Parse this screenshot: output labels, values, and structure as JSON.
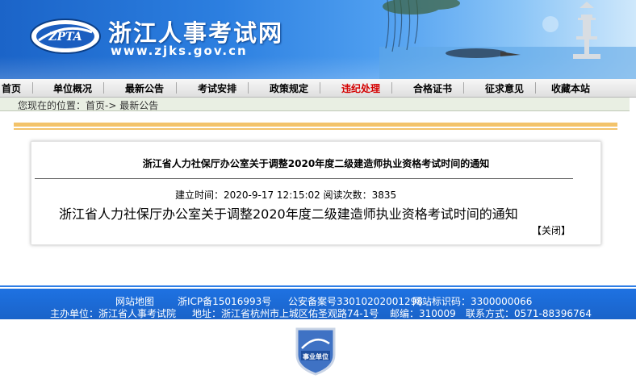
{
  "header": {
    "logo_text": "ZPTA",
    "site_title": "浙江人事考试网",
    "site_url": "www.zjks.gov.cn"
  },
  "nav": {
    "items": [
      {
        "label": "首页"
      },
      {
        "label": "单位概况"
      },
      {
        "label": "最新公告"
      },
      {
        "label": "考试安排"
      },
      {
        "label": "政策规定"
      },
      {
        "label": "违纪处理",
        "active": true
      },
      {
        "label": "合格证书"
      },
      {
        "label": "征求意见"
      },
      {
        "label": "收藏本站"
      }
    ],
    "active_color": "#d40000"
  },
  "breadcrumb": {
    "text": "您现在的位置：首页-> 最新公告"
  },
  "announcement": {
    "title": "浙江省人力社保厅办公室关于调整2020年度二级建造师执业资格考试时间的通知",
    "meta": "建立时间：2020-9-17 12:15:02 阅读次数：3835",
    "body": "浙江省人力社保厅办公室关于调整2020年度二级建造师执业资格考试时间的通知",
    "close_label": "【关闭】"
  },
  "footer": {
    "line1_links": [
      {
        "label": "网站地图"
      },
      {
        "label": "浙ICP备15016993号"
      },
      {
        "label": "公安备案号33010202001298"
      }
    ],
    "site_id": "网站标识码：3300000066",
    "host": "主办单位：浙江省人事考试院",
    "address": "地址：浙江省杭州市上城区佑圣观路74-1号",
    "postcode": "邮编：310009",
    "contact": "联系方式：0571-88396764",
    "badge_text": "事业单位"
  },
  "colors": {
    "banner_blue": "#1b64c8",
    "footer_blue": "#1a63c9",
    "accent_orange": "#f3c36a"
  }
}
